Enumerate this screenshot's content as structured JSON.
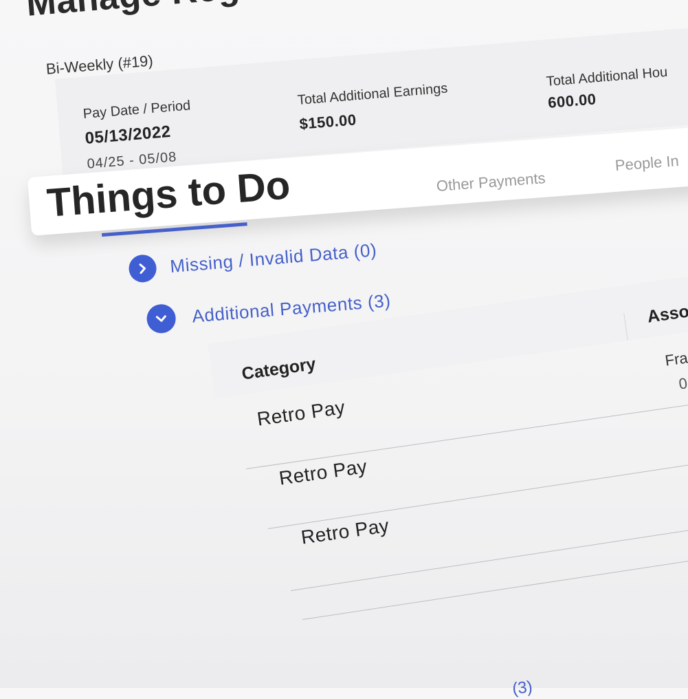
{
  "page": {
    "title": "Manage Regular Payroll",
    "frequency": "Bi-Weekly (#19)"
  },
  "summary": {
    "pay_date_label": "Pay Date / Period",
    "pay_date": "05/13/2022",
    "period": "04/25 - 05/08",
    "earnings_label": "Total Additional Earnings",
    "earnings_value": "$150.00",
    "hours_label": "Total Additional Hou",
    "hours_value": "600.00"
  },
  "tabs": {
    "active": "Things to Do",
    "other_payments": "Other Payments",
    "people": "People In"
  },
  "sections": [
    {
      "label": "Missing / Invalid Data (0)",
      "expanded": false
    },
    {
      "label": "Additional Payments (3)",
      "expanded": true
    }
  ],
  "table": {
    "headers": {
      "category": "Category",
      "associated": "Asso"
    },
    "sub_header": "Fra",
    "sub_value": "0",
    "rows": [
      {
        "category": "Retro Pay"
      },
      {
        "category": "Retro Pay"
      },
      {
        "category": "Retro Pay"
      }
    ]
  },
  "footer_fragment": "(3)",
  "colors": {
    "accent": "#3f5ed3",
    "text": "#222222",
    "muted": "#999999"
  }
}
